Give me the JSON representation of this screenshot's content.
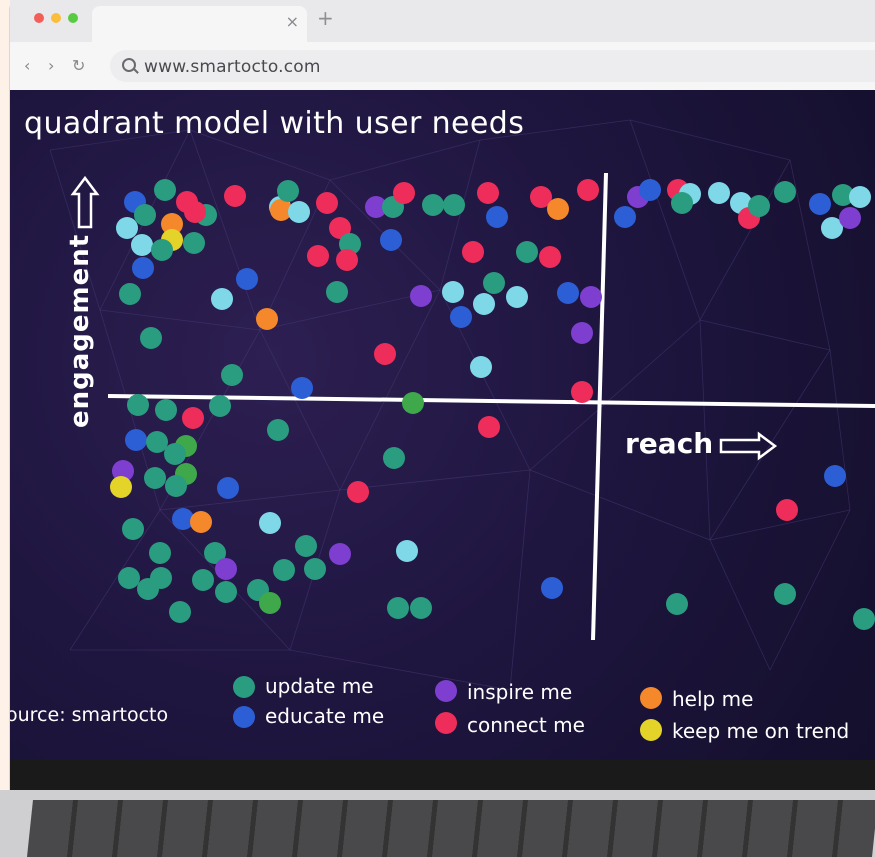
{
  "browser": {
    "url": "www.smartocto.com",
    "window_dots": [
      "#f25f58",
      "#fbbe3c",
      "#58cb42"
    ],
    "close_symbol": "×",
    "new_tab_symbol": "+",
    "nav": {
      "back": "‹",
      "forward": "›",
      "reload": "↻"
    }
  },
  "chart": {
    "title": "quadrant model with user needs",
    "y_axis_label": "engagement",
    "x_axis_label": "reach",
    "source": "ource: smartocto"
  },
  "legend": [
    {
      "label": "update me",
      "color": "#2a9c7f"
    },
    {
      "label": "educate me",
      "color": "#2c5fd6"
    },
    {
      "label": "inspire me",
      "color": "#7e3ecf"
    },
    {
      "label": "connect me",
      "color": "#ef2d5a"
    },
    {
      "label": "help me",
      "color": "#f4882a"
    },
    {
      "label": "keep me on trend",
      "color": "#e4d42a"
    }
  ],
  "colors": {
    "update_me": "#2a9c7f",
    "educate_me": "#2c5fd6",
    "inspire_me": "#7e3ecf",
    "connect_me": "#ef2d5a",
    "help_me": "#f4882a",
    "keep_me_on_trend": "#e4d42a",
    "light_blue": "#7fd8e8",
    "green": "#3ea84a"
  }
}
